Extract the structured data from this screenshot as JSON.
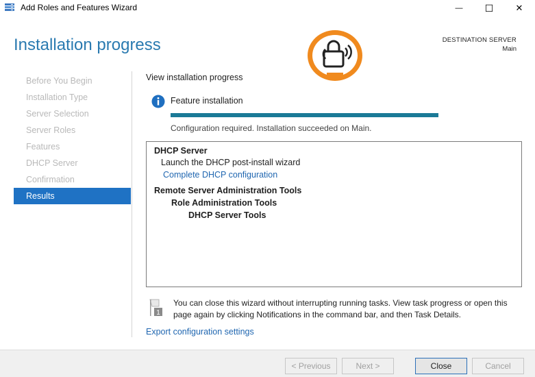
{
  "window": {
    "title": "Add Roles and Features Wizard",
    "min_glyph": "—",
    "max_glyph": "☐",
    "close_glyph": "✕"
  },
  "header": {
    "page_title": "Installation progress",
    "destination_label": "DESTINATION SERVER",
    "destination_value": "Main"
  },
  "sidebar": {
    "items": [
      {
        "label": "Before You Begin"
      },
      {
        "label": "Installation Type"
      },
      {
        "label": "Server Selection"
      },
      {
        "label": "Server Roles"
      },
      {
        "label": "Features"
      },
      {
        "label": "DHCP Server"
      },
      {
        "label": "Confirmation"
      },
      {
        "label": "Results"
      }
    ],
    "active_index": 7
  },
  "main": {
    "section_label": "View installation progress",
    "feature_label": "Feature installation",
    "progress_percent": 100,
    "status_text": "Configuration required. Installation succeeded on Main.",
    "results": {
      "line0": "DHCP Server",
      "line1": "Launch the DHCP post-install wizard",
      "line2": "Complete DHCP configuration",
      "line3": "Remote Server Administration Tools",
      "line4": "Role Administration Tools",
      "line5": "DHCP Server Tools"
    },
    "note_text": "You can close this wizard without interrupting running tasks. View task progress or open this page again by clicking Notifications in the command bar, and then Task Details.",
    "note_badge": "1",
    "export_link": "Export configuration settings"
  },
  "footer": {
    "previous_label": "< Previous",
    "next_label": "Next >",
    "close_label": "Close",
    "cancel_label": "Cancel"
  },
  "colors": {
    "accent": "#1f72c4",
    "progress": "#1b7a97",
    "link": "#1f66b0",
    "heading": "#2a7ab0"
  },
  "icons": {
    "app": "server-manager-icon",
    "info": "info-icon",
    "note": "flag-notification-icon",
    "logo": "watermark-logo"
  }
}
